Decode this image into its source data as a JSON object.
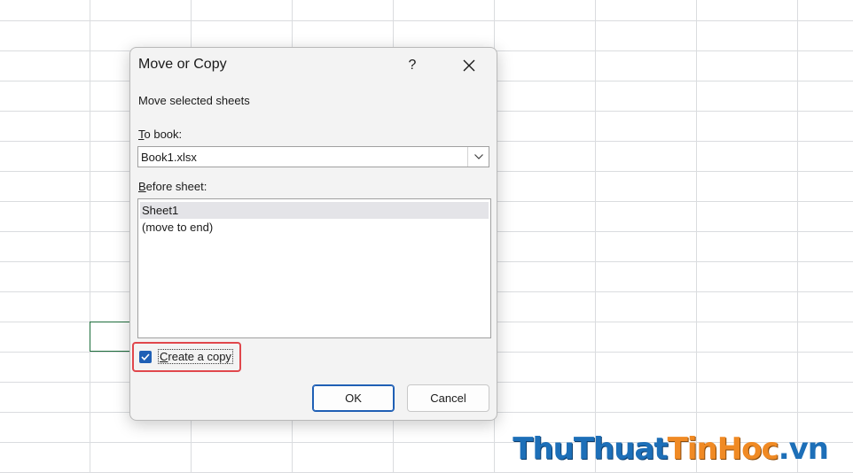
{
  "dialog": {
    "title": "Move or Copy",
    "help_symbol": "?",
    "subtitle": "Move selected sheets",
    "to_book": {
      "label_mnemonic": "T",
      "label_rest": "o book:",
      "value": "Book1.xlsx"
    },
    "before_sheet": {
      "label_mnemonic": "B",
      "label_rest": "efore sheet:",
      "items": [
        "Sheet1",
        "(move to end)"
      ],
      "selected_index": 0
    },
    "create_copy": {
      "label_mnemonic": "C",
      "label_rest": "reate a copy",
      "checked": true
    },
    "buttons": {
      "ok": "OK",
      "cancel": "Cancel"
    }
  },
  "watermark": {
    "part1": "ThuThuat",
    "part2": "TinHoc",
    "part3": ".vn"
  },
  "colors": {
    "accent": "#1f5fb5",
    "highlight_border": "#e0474c",
    "active_cell_border": "#1e6e3c"
  },
  "icons": {
    "close": "close-icon",
    "dropdown": "chevron-down-icon",
    "check": "checkmark-icon"
  }
}
